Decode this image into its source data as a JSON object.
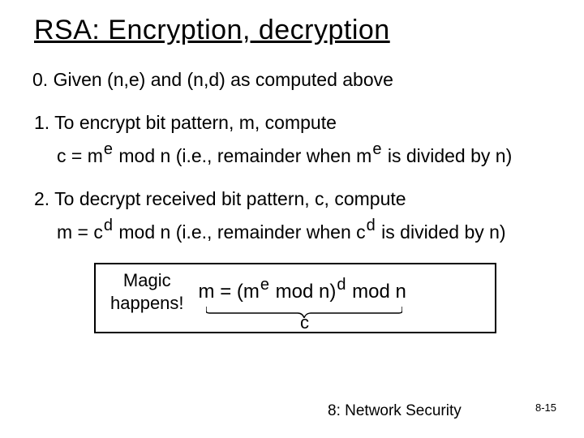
{
  "title": "RSA: Encryption, decryption",
  "steps": {
    "s0": {
      "num": "0.",
      "text": "Given (n,e) and (n,d) as computed above"
    },
    "s1": {
      "num": "1.",
      "text": "To encrypt bit pattern, m, compute",
      "formula_lhs": "c = m",
      "formula_exp": "e",
      "formula_mod": " mod  n",
      "explain_pre": "  (i.e., remainder when m",
      "explain_exp": "e",
      "explain_post": " is divided by n)"
    },
    "s2": {
      "num": "2.",
      "text": "To decrypt received bit pattern, c, compute",
      "formula_lhs": "m = c",
      "formula_exp": "d",
      "formula_mod": " mod  n",
      "explain_pre": "  (i.e., remainder when c",
      "explain_exp": "d",
      "explain_post": " is divided by n)"
    }
  },
  "magic": {
    "label1": "Magic",
    "label2": "happens!",
    "f1": "m  =  (m",
    "e1": "e",
    "f2": " mod  n)",
    "e2": "d",
    "f3": " mod  n",
    "under": "c"
  },
  "footer": {
    "chapter": "8: Network Security",
    "page": "8-15"
  }
}
